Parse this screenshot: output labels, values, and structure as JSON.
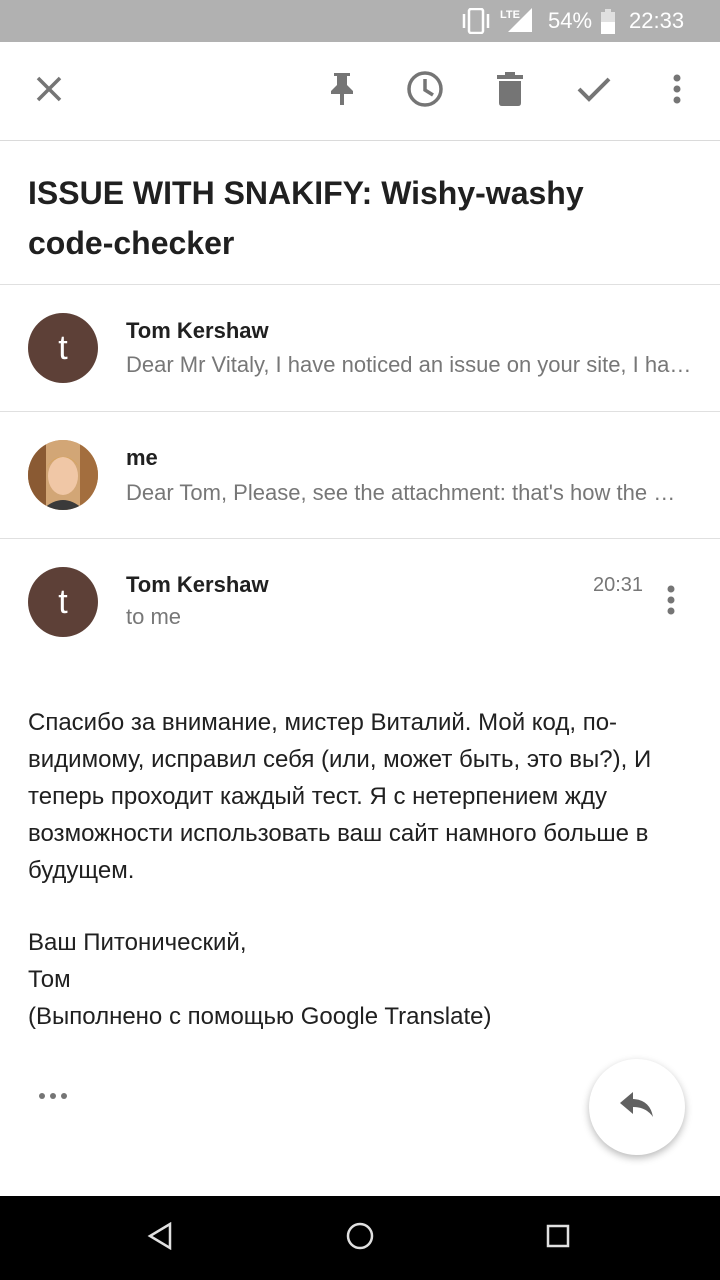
{
  "status_bar": {
    "network": "LTE",
    "battery": "54%",
    "time": "22:33"
  },
  "toolbar": {
    "icons": [
      "close-icon",
      "pin-icon",
      "snooze-icon",
      "delete-icon",
      "done-icon",
      "more-vert-icon"
    ]
  },
  "subject": "ISSUE WITH SNAKIFY: Wishy-washy code-checker",
  "thread": [
    {
      "avatar_letter": "t",
      "sender": "Tom Kershaw",
      "snippet": "Dear Mr Vitaly, I have noticed an issue on your site, I have noticed an issue on your site"
    },
    {
      "sender": "me",
      "snippet": "Dear Tom, Please, see the attachment: that's how the checker works"
    }
  ],
  "open_message": {
    "avatar_letter": "t",
    "sender": "Tom Kershaw",
    "recipient": "to me",
    "time": "20:31",
    "body": "Спасибо за внимание, мистер Виталий. Мой код, по-видимому, исправил себя (или, может быть, это вы?), И теперь проходит каждый тест. Я с нетерпением жду возможности использовать ваш сайт намного больше в будущем.",
    "signature_lines": [
      "Ваш Питонический,",
      "Том",
      "(Выполнено с помощью Google Translate)"
    ]
  },
  "colors": {
    "status_bar": "#b1b1b1",
    "avatar": "#5d4037",
    "icon_gray": "#757575"
  }
}
